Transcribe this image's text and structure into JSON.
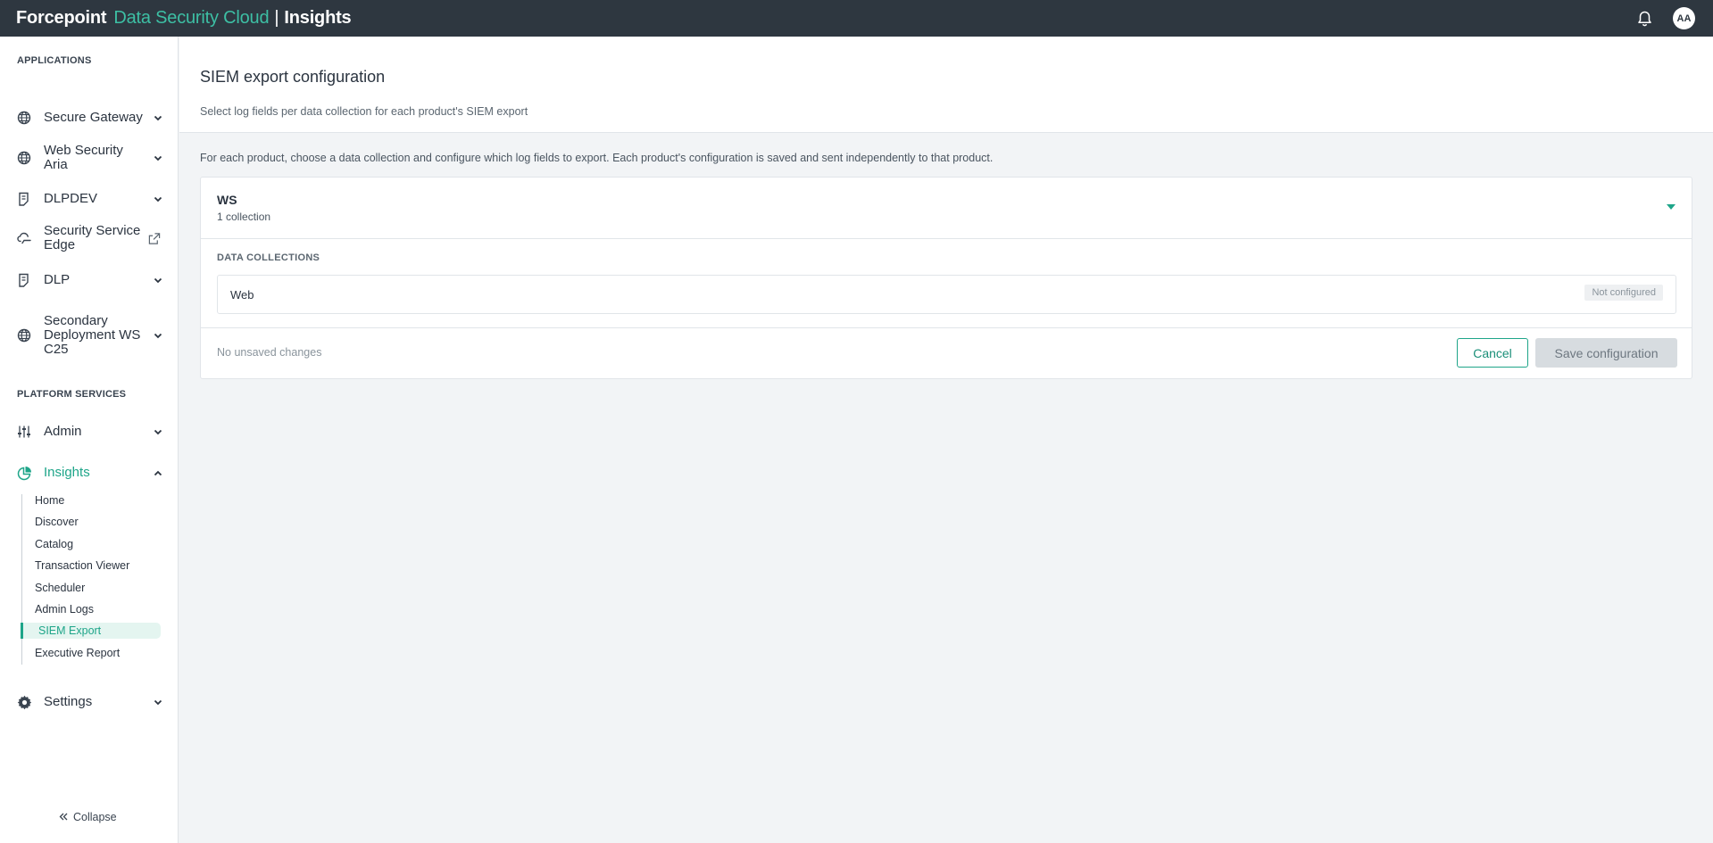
{
  "topbar": {
    "brand_primary": "Forcepoint",
    "brand_product": "Data Security Cloud",
    "brand_separator": "|",
    "brand_app": "Insights",
    "avatar_initials": "AA",
    "accent_color": "#3dbfa4"
  },
  "sidebar": {
    "applications_label": "APPLICATIONS",
    "applications": [
      {
        "label": "Secure Gateway",
        "icon": "globe-icon",
        "trailing": "chevron-down-icon"
      },
      {
        "label": "Web Security Aria",
        "icon": "globe-icon",
        "trailing": "chevron-down-icon"
      },
      {
        "label": "DLPDEV",
        "icon": "document-icon",
        "trailing": "chevron-down-icon"
      },
      {
        "label": "Security Service Edge",
        "icon": "cloud-icon",
        "trailing": "external-link-icon"
      },
      {
        "label": "DLP",
        "icon": "document-icon",
        "trailing": "chevron-down-icon"
      },
      {
        "label": "Secondary Deployment WS C25",
        "icon": "globe-icon",
        "trailing": "chevron-down-icon"
      }
    ],
    "platform_label": "PLATFORM SERVICES",
    "platform": [
      {
        "label": "Admin",
        "icon": "sliders-icon",
        "trailing": "chevron-down-icon"
      },
      {
        "label": "Insights",
        "icon": "pie-chart-icon",
        "trailing": "chevron-up-icon"
      }
    ],
    "insights_sub": [
      {
        "label": "Home"
      },
      {
        "label": "Discover"
      },
      {
        "label": "Catalog"
      },
      {
        "label": "Transaction Viewer"
      },
      {
        "label": "Scheduler"
      },
      {
        "label": "Admin Logs"
      },
      {
        "label": "SIEM Export"
      },
      {
        "label": "Executive Report"
      }
    ],
    "settings": {
      "label": "Settings",
      "icon": "gear-icon",
      "trailing": "chevron-down-icon"
    },
    "collapse_label": "Collapse"
  },
  "main": {
    "title": "SIEM export configuration",
    "subtitle": "Select log fields per data collection for each product's SIEM export",
    "intro": "For each product, choose a data collection and configure which log fields to export. Each product's configuration is saved and sent independently to that product.",
    "product": {
      "name": "WS",
      "count": "1 collection",
      "collections_label": "DATA COLLECTIONS",
      "collections": [
        {
          "name": "Web",
          "status": "Not configured"
        }
      ]
    },
    "footer": {
      "status": "No unsaved changes",
      "cancel_label": "Cancel",
      "save_label": "Save configuration"
    }
  }
}
